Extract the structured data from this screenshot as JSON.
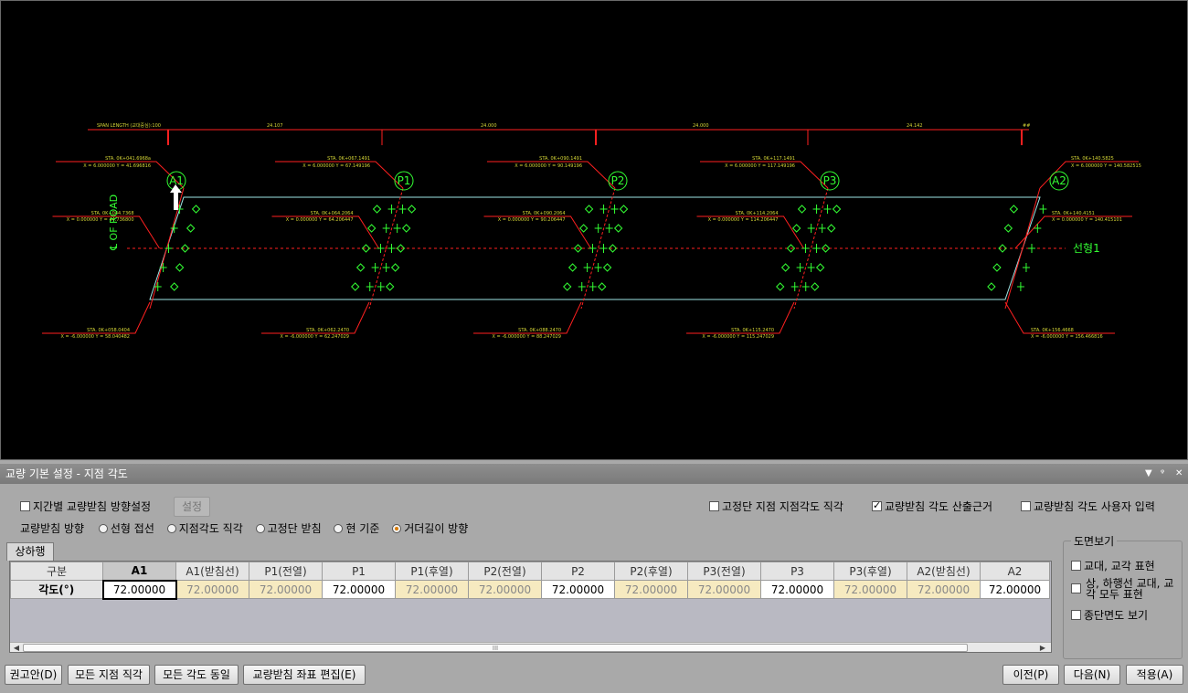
{
  "cad": {
    "span_header": "SPAN LENGTH (교대중심):100",
    "span_values": [
      "24.107",
      "24.000",
      "24.000",
      "24.142",
      "##"
    ],
    "supports": [
      "A1",
      "P1",
      "P2",
      "P3",
      "A2"
    ],
    "road_label": "℄ OF ROAD",
    "alignment_label": "선형1",
    "sta_top": [
      "STA. 0K+041.6968a",
      "STA. 0K+067.1491",
      "STA. 0K+090.1491",
      "STA. 0K+117.1491",
      "STA. 0K+140.5825"
    ],
    "sta_top_sub": [
      "X = 6.000000  Y = 41.696816",
      "X = 6.000000  Y = 67.149196",
      "X = 6.000000  Y = 90.149196",
      "X = 6.000000  Y = 117.149196",
      "X = 6.000000  Y = 140.582515"
    ],
    "sta_mid": [
      "STA. 0K+044.7368",
      "STA. 0K+064.2064",
      "STA. 0K+090.2064",
      "STA. 0K+114.2064",
      "STA. 0K+140.4151"
    ],
    "sta_mid_sub": [
      "X = 0.000000  Y = 44.736800",
      "X = 0.000000  Y = 64.206447",
      "X = 0.000000  Y = 90.206447",
      "X = 0.000000  Y = 114.206447",
      "X = 0.000000  Y = 140.415101"
    ],
    "sta_bot": [
      "STA. 0K+058.0404",
      "STA. 0K+062.2470",
      "STA. 0K+088.2470",
      "STA. 0K+115.2470",
      "STA. 0K+156.4668"
    ],
    "sta_bot_sub": [
      "X = -6.000000  Y = 58.040482",
      "X = -6.000000  Y = 62.247029",
      "X = -6.000000  Y = 88.247029",
      "X = -6.000000  Y = 115.247029",
      "X = -6.000000  Y = 156.466816"
    ],
    "colors": {
      "background": "#000000",
      "dimension": "#ff2020",
      "deck": "#9ee6e6",
      "label": "#33ff33",
      "sta_text": "#d6d636"
    }
  },
  "panel": {
    "title": "교량 기본 설정 - 지점 각도",
    "title_controls": [
      "▼",
      "ᵠ",
      "✕"
    ],
    "chk_span_dir": "지간별 교량받침 방향설정",
    "btn_setting": "설정",
    "chk_fixed_right": "고정단 지점 지점각도 직각",
    "chk_angle_basis": "교량받침 각도 산출근거",
    "chk_user_input": "교량받침 각도 사용자 입력",
    "dir_label": "교량받침 방향",
    "radios": [
      {
        "label": "선형 접선",
        "on": false
      },
      {
        "label": "지점각도 직각",
        "on": false
      },
      {
        "label": "고정단 받침",
        "on": false
      },
      {
        "label": "현 기준",
        "on": false
      },
      {
        "label": "거더길이 방향",
        "on": true
      }
    ],
    "tab_label": "상하행",
    "grid": {
      "corner_header": "구분",
      "row_header": "각도(°)",
      "columns": [
        "A1",
        "A1(받침선)",
        "P1(전열)",
        "P1",
        "P1(후열)",
        "P2(전열)",
        "P2",
        "P2(후열)",
        "P3(전열)",
        "P3",
        "P3(후열)",
        "A2(받침선)",
        "A2"
      ],
      "values": [
        "72.00000",
        "72.00000",
        "72.00000",
        "72.00000",
        "72.00000",
        "72.00000",
        "72.00000",
        "72.00000",
        "72.00000",
        "72.00000",
        "72.00000",
        "72.00000",
        "72.00000"
      ],
      "readonly": [
        false,
        true,
        true,
        false,
        true,
        true,
        false,
        true,
        true,
        false,
        true,
        true,
        false
      ]
    },
    "scroll_grip": "III",
    "view_group": {
      "title": "도면보기",
      "options": [
        "교대, 교각 표현",
        "상, 하행선 교대, 교각 모두 표현",
        "종단면도 보기"
      ]
    },
    "buttons": {
      "recommend": "권고안(D)",
      "all_right_angle": "모든 지점 직각",
      "all_same_angle": "모든 각도 동일",
      "edit_coords": "교량받침 좌표 편집(E)",
      "prev": "이전(P)",
      "next": "다음(N)",
      "apply": "적용(A)"
    }
  }
}
